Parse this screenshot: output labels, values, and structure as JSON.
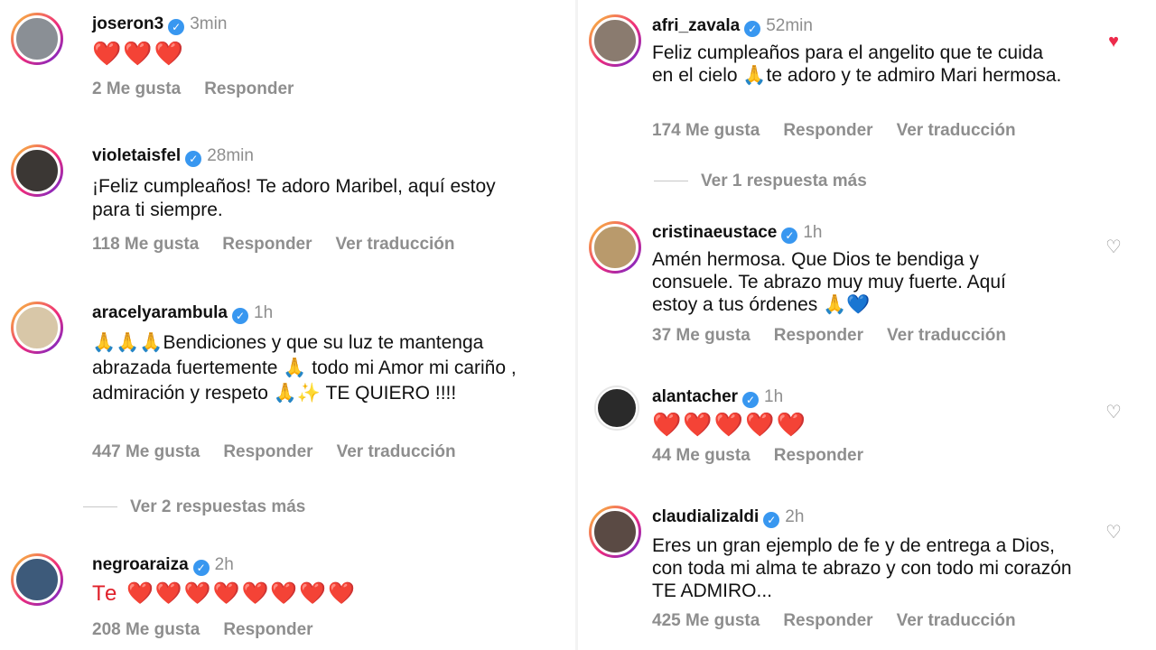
{
  "left": {
    "comments": [
      {
        "username": "joseron3",
        "time": "3min",
        "text": "❤️❤️❤️",
        "likes": "2 Me gusta",
        "reply": "Responder",
        "translate": ""
      },
      {
        "username": "violetaisfel",
        "time": "28min",
        "text": "¡Feliz cumpleaños! Te adoro Maribel, aquí estoy para ti siempre.",
        "likes": "118 Me gusta",
        "reply": "Responder",
        "translate": "Ver traducción"
      },
      {
        "username": "aracelyarambula",
        "time": "1h",
        "text": "🙏🙏🙏Bendiciones y que su luz te mantenga abrazada fuertemente 🙏 todo mi Amor mi cariño , admiración y respeto 🙏✨ TE QUIERO !!!!",
        "likes": "447 Me gusta",
        "reply": "Responder",
        "translate": "Ver traducción"
      },
      {
        "username": "negroaraiza",
        "time": "2h",
        "text": "Te ❤️❤️❤️❤️❤️❤️❤️❤️",
        "likes": "208 Me gusta",
        "reply": "Responder",
        "translate": ""
      }
    ],
    "more_replies": "Ver 2 respuestas más"
  },
  "right": {
    "comments": [
      {
        "username": "afri_zavala",
        "time": "52min",
        "text": "Feliz cumpleaños para el angelito que te cuida en el cielo 🙏te adoro y te admiro  Mari hermosa.",
        "likes": "174 Me gusta",
        "reply": "Responder",
        "translate": "Ver traducción"
      },
      {
        "username": "cristinaeustace",
        "time": "1h",
        "text": "Amén hermosa. Que Dios te bendiga y consuele. Te abrazo muy muy fuerte. Aquí estoy a tus órdenes 🙏💙",
        "likes": "37 Me gusta",
        "reply": "Responder",
        "translate": "Ver traducción"
      },
      {
        "username": "alantacher",
        "time": "1h",
        "text": "❤️❤️❤️❤️❤️",
        "likes": "44 Me gusta",
        "reply": "Responder",
        "translate": ""
      },
      {
        "username": "claudializaldi",
        "time": "2h",
        "text": "Eres un gran ejemplo de fe y de entrega a Dios, con toda mi alma te abrazo y con todo mi corazón TE ADMIRO...",
        "likes": "425 Me gusta",
        "reply": "Responder",
        "translate": "Ver traducción"
      }
    ],
    "more_replies": "Ver 1 respuesta más"
  },
  "icons": {
    "verified": "verified-badge-icon",
    "like": "heart-icon"
  },
  "colors": {
    "liked": "#ed2a4b",
    "verified": "#3897f0",
    "muted": "#8e8e8e"
  }
}
